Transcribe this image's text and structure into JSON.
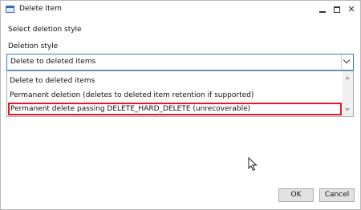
{
  "window": {
    "title": "Delete Item",
    "minimize_icon": "minimize-icon",
    "maximize_icon": "maximize-icon",
    "close_icon": "close-icon",
    "close_glyph": "✕"
  },
  "dialog": {
    "instruction": "Select deletion style",
    "field_label": "Deletion style"
  },
  "combo": {
    "selected_value": "Delete to deleted items",
    "dropdown_icon": "chevron-down-icon",
    "expanded": true
  },
  "options": [
    {
      "label": "Delete to deleted items"
    },
    {
      "label": "Permanent deletion (deletes to deleted item retention if supported)"
    },
    {
      "label": "Permanent delete passing DELETE_HARD_DELETE (unrecoverable)",
      "highlighted": true
    }
  ],
  "buttons": {
    "ok": "OK",
    "cancel": "Cancel"
  },
  "colors": {
    "focus_border": "#2f7bd4",
    "highlight_border": "#e0182d"
  }
}
